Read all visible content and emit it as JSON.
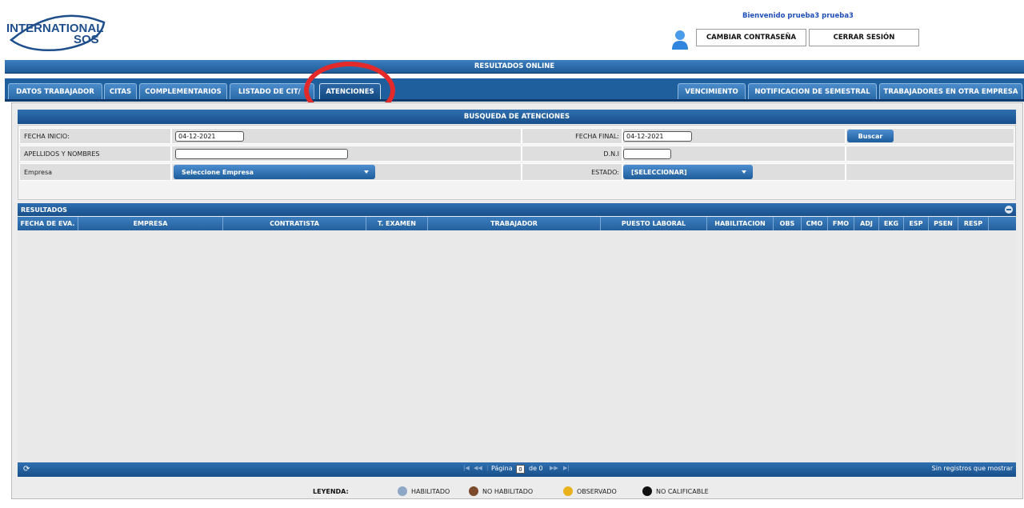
{
  "header": {
    "logo_line1": "INTERNATIONAL",
    "logo_line2": "SOS",
    "welcome": "Bienvenido prueba3 prueba3",
    "change_password": "CAMBIAR CONTRASEÑA",
    "logout": "CERRAR SESIÓN"
  },
  "main_title": "RESULTADOS ONLINE",
  "tabs_left": [
    "DATOS TRABAJADOR",
    "CITAS",
    "COMPLEMENTARIOS",
    "LISTADO DE CITAS",
    "ATENCIONES"
  ],
  "tabs_left_visible": {
    "listado": "LISTADO DE CIT/"
  },
  "tabs_right": [
    "VENCIMIENTO",
    "NOTIFICACION DE SEMESTRAL",
    "TRABAJADORES EN OTRA EMPRESA"
  ],
  "active_tab": "ATENCIONES",
  "search": {
    "title": "BUSQUEDA DE ATENCIONES",
    "fecha_inicio_label": "FECHA INICIO:",
    "fecha_inicio_value": "04-12-2021",
    "fecha_final_label": "FECHA FINAL:",
    "fecha_final_value": "04-12-2021",
    "buscar": "Buscar",
    "apellidos_label": "APELLIDOS Y NOMBRES",
    "apellidos_value": "",
    "dni_label": "D.N.I",
    "dni_value": "",
    "empresa_label": "Empresa",
    "empresa_select": "Seleccione Empresa",
    "estado_label": "ESTADO:",
    "estado_select": "[SELECCIONAR]"
  },
  "results": {
    "title": "RESULTADOS",
    "columns": [
      "FECHA DE EVA.",
      "EMPRESA",
      "CONTRATISTA",
      "T. EXAMEN",
      "TRABAJADOR",
      "PUESTO LABORAL",
      "HABILITACION",
      "OBS",
      "CMO",
      "FMO",
      "ADJ",
      "EKG",
      "ESP",
      "PSEN",
      "RESP"
    ],
    "rows": []
  },
  "pager": {
    "page_label": "Página",
    "page_value": "0",
    "of_label": "de 0",
    "no_records": "Sin registros que mostrar"
  },
  "legend": {
    "title": "LEYENDA:",
    "items": [
      {
        "label": "HABILITADO",
        "color": "#8ea7c7"
      },
      {
        "label": "NO HABILITADO",
        "color": "#7a4a2a"
      },
      {
        "label": "OBSERVADO",
        "color": "#e9b21c"
      },
      {
        "label": "NO CALIFICABLE",
        "color": "#111111"
      }
    ]
  },
  "colors": {
    "primary": "#1f5f9e",
    "annotation": "#e22a2a"
  }
}
